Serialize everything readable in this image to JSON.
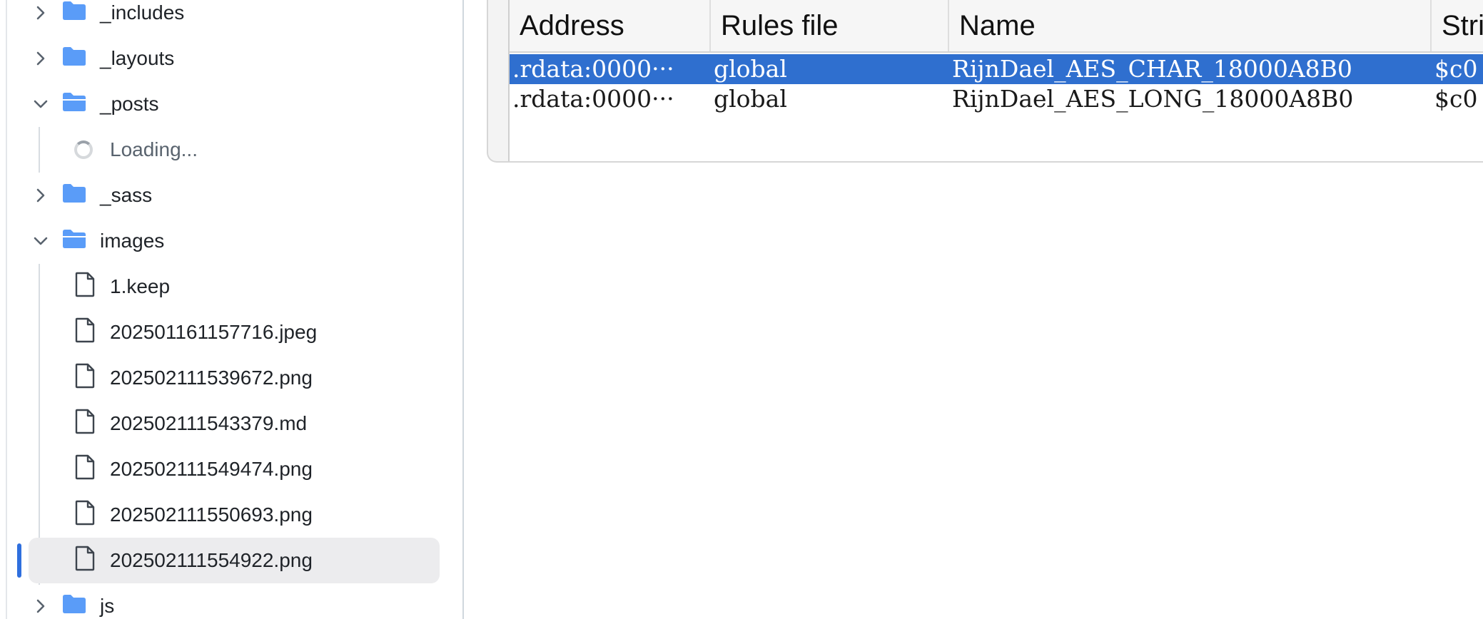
{
  "file_tree": {
    "items": [
      {
        "type": "folder",
        "expanded": false,
        "label": "_includes"
      },
      {
        "type": "folder",
        "expanded": false,
        "label": "_layouts"
      },
      {
        "type": "folder",
        "expanded": true,
        "label": "_posts"
      },
      {
        "type": "loading",
        "label": "Loading..."
      },
      {
        "type": "folder",
        "expanded": false,
        "label": "_sass"
      },
      {
        "type": "folder",
        "expanded": true,
        "label": "images"
      },
      {
        "type": "file",
        "label": "1.keep"
      },
      {
        "type": "file",
        "label": "202501161157716.jpeg"
      },
      {
        "type": "file",
        "label": "202502111539672.png"
      },
      {
        "type": "file",
        "label": "202502111543379.md"
      },
      {
        "type": "file",
        "label": "202502111549474.png"
      },
      {
        "type": "file",
        "label": "202502111550693.png"
      },
      {
        "type": "file",
        "label": "202502111554922.png",
        "selected": true
      },
      {
        "type": "folder",
        "expanded": false,
        "label": "js"
      }
    ]
  },
  "table": {
    "columns": [
      "Address",
      "Rules file",
      "Name",
      "Stri"
    ],
    "rows": [
      {
        "address": ".rdata:0000···",
        "rules_file": "global",
        "name": "RijnDael_AES_CHAR_18000A8B0",
        "string": "$c0",
        "selected": true
      },
      {
        "address": ".rdata:0000···",
        "rules_file": "global",
        "name": "RijnDael_AES_LONG_18000A8B0",
        "string": "$c0",
        "selected": false
      }
    ]
  },
  "colors": {
    "folder": "#5a9cf8",
    "selection_blue": "#2f6fcf",
    "tree_selected_bg": "#ececee",
    "selection_bar": "#2f6fde"
  }
}
